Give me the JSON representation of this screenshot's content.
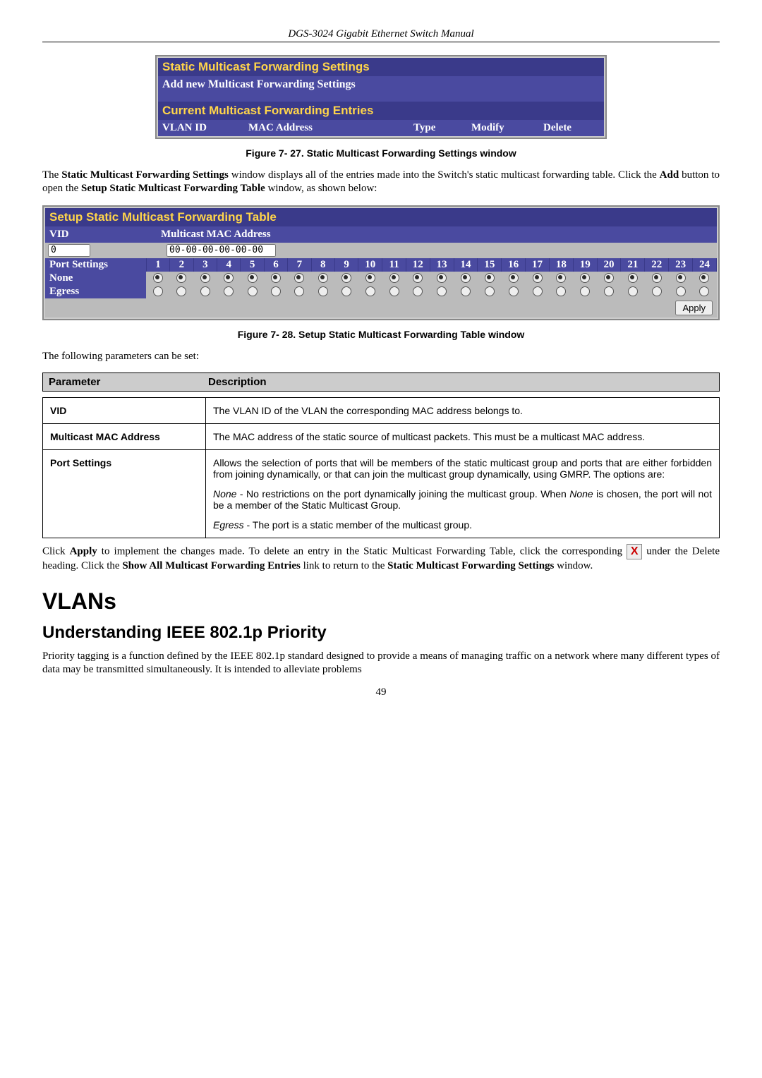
{
  "doc_header": "DGS-3024 Gigabit Ethernet Switch Manual",
  "page_num": "49",
  "shot1": {
    "title": "Static Multicast Forwarding Settings",
    "add_bar": "Add new Multicast Forwarding Settings",
    "entries_title": "Current Multicast Forwarding Entries",
    "cols": {
      "vlan": "VLAN ID",
      "mac": "MAC Address",
      "type": "Type",
      "modify": "Modify",
      "delete": "Delete"
    }
  },
  "fig1_cap": "Figure 7- 27.  Static Multicast Forwarding Settings window",
  "para1": "The Static Multicast Forwarding Settings window displays all of the entries made into the Switch's static multicast forwarding table. Click the Add button to open the Setup Static Multicast Forwarding Table window, as shown below:",
  "shot2": {
    "title": "Setup Static Multicast Forwarding Table",
    "vid_label": "VID",
    "mac_label": "Multicast MAC Address",
    "vid_value": "0",
    "mac_value": "00-00-00-00-00-00",
    "ports_label": "Port Settings",
    "row_none": "None",
    "row_egress": "Egress",
    "apply": "Apply"
  },
  "fig2_cap": "Figure 7- 28.  Setup Static Multicast Forwarding Table window",
  "para2": "The following parameters can be set:",
  "param_head": {
    "p": "Parameter",
    "d": "Description"
  },
  "params": {
    "vid": {
      "name": "VID",
      "desc": "The VLAN ID of the VLAN the corresponding MAC address belongs to."
    },
    "mac": {
      "name": "Multicast MAC Address",
      "desc": "The MAC address of the static source of multicast packets. This must be a multicast MAC address."
    },
    "ports": {
      "name": "Port Settings",
      "d1": "Allows the selection of ports that will be members of the static multicast group and ports that are either forbidden from joining dynamically, or that can join the multicast group dynamically, using GMRP. The options are:",
      "d2": "None - No restrictions on the port dynamically joining the multicast group. When None is chosen, the port will not be a member of the Static Multicast Group.",
      "d3": "Egress - The port is a static member of the multicast group."
    }
  },
  "para3a": "Click Apply to implement the changes made. To delete an entry in the Static Multicast Forwarding Table, click the corresponding ",
  "para3b": " under the Delete heading. Click the Show All Multicast Forwarding Entries link to return to the Static Multicast Forwarding Settings window.",
  "h1": "VLANs",
  "h2": "Understanding IEEE 802.1p Priority",
  "para4": "Priority tagging is a function defined by the IEEE 802.1p standard designed to provide a means of managing traffic on a network where many different types of data may be transmitted simultaneously. It is intended to alleviate problems"
}
